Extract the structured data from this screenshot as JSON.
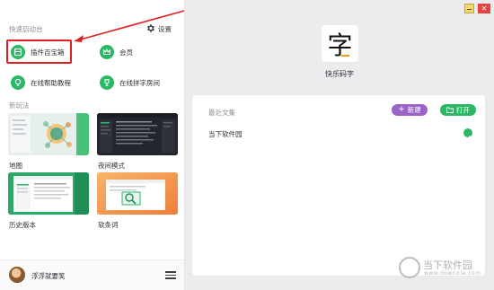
{
  "window": {
    "minimize_icon": "minimize-icon",
    "close_icon": "close-icon",
    "close_glyph": "✕"
  },
  "sidebar": {
    "quick_start_label": "快速启动台",
    "settings_label": "设置",
    "settings_icon": "gear-icon",
    "quick_actions": [
      {
        "label": "插件百宝箱",
        "icon": "box-icon"
      },
      {
        "label": "会员",
        "icon": "crown-icon"
      },
      {
        "label": "在线帮助教程",
        "icon": "lightbulb-icon"
      },
      {
        "label": "在线拼字房间",
        "icon": "trophy-icon"
      }
    ],
    "new_play_label": "新玩法",
    "features": [
      {
        "label": "地图",
        "thumb": "map-thumbnail"
      },
      {
        "label": "夜间模式",
        "thumb": "night-mode-thumbnail"
      },
      {
        "label": "历史版本",
        "thumb": "history-thumbnail"
      },
      {
        "label": "软条词",
        "thumb": "search-thumbnail"
      }
    ],
    "user": {
      "name": "浮浮就要笑",
      "menu_icon": "hamburger-menu-icon"
    }
  },
  "main": {
    "app_logo_char": "字",
    "app_name": "快乐码字",
    "recent_title": "最近文集",
    "new_button_label": "新建",
    "new_button_icon": "plus-icon",
    "open_button_label": "打开",
    "open_button_icon": "folder-icon",
    "recent_files": [
      {
        "name": "当下软件园",
        "status_icon": "check-circle-icon"
      }
    ]
  },
  "watermark": {
    "text": "当下软件园",
    "url": "www.downxia.com"
  },
  "colors": {
    "accent_green": "#2bb865",
    "accent_purple": "#9b63c9",
    "annotation_red": "#e02020"
  }
}
